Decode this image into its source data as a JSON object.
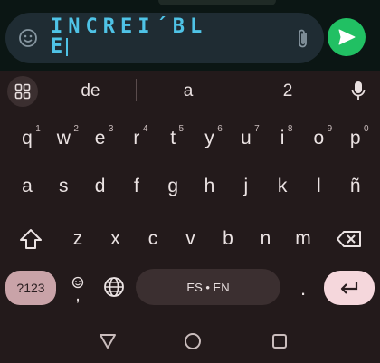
{
  "compose": {
    "typed_line1": "INCREI´BL",
    "typed_line2": "E"
  },
  "suggestions": [
    "de",
    "a",
    "2"
  ],
  "keyboard": {
    "row1": [
      {
        "key": "q",
        "hint": "1"
      },
      {
        "key": "w",
        "hint": "2"
      },
      {
        "key": "e",
        "hint": "3"
      },
      {
        "key": "r",
        "hint": "4"
      },
      {
        "key": "t",
        "hint": "5"
      },
      {
        "key": "y",
        "hint": "6"
      },
      {
        "key": "u",
        "hint": "7"
      },
      {
        "key": "i",
        "hint": "8"
      },
      {
        "key": "o",
        "hint": "9"
      },
      {
        "key": "p",
        "hint": "0"
      }
    ],
    "row2": [
      "a",
      "s",
      "d",
      "f",
      "g",
      "h",
      "j",
      "k",
      "l",
      "ñ"
    ],
    "row3": [
      "z",
      "x",
      "c",
      "v",
      "b",
      "n",
      "m"
    ],
    "symbols_label": "?123",
    "comma_label": ",",
    "space_label": "ES • EN",
    "period_label": "."
  },
  "colors": {
    "accent": "#4fc3e6",
    "send": "#21c063",
    "symbols_key": "#c9a3a8",
    "enter_key": "#f5d7dc",
    "keyboard_bg": "#231a1b"
  },
  "icons": {
    "emoji": "emoji-icon",
    "attach": "paperclip-icon",
    "send": "send-icon",
    "grid": "grid-icon",
    "mic": "mic-icon",
    "shift": "shift-icon",
    "backspace": "backspace-icon",
    "globe": "globe-icon",
    "enter": "enter-icon",
    "nav_back": "back-icon",
    "nav_home": "home-icon",
    "nav_recents": "recents-icon"
  }
}
